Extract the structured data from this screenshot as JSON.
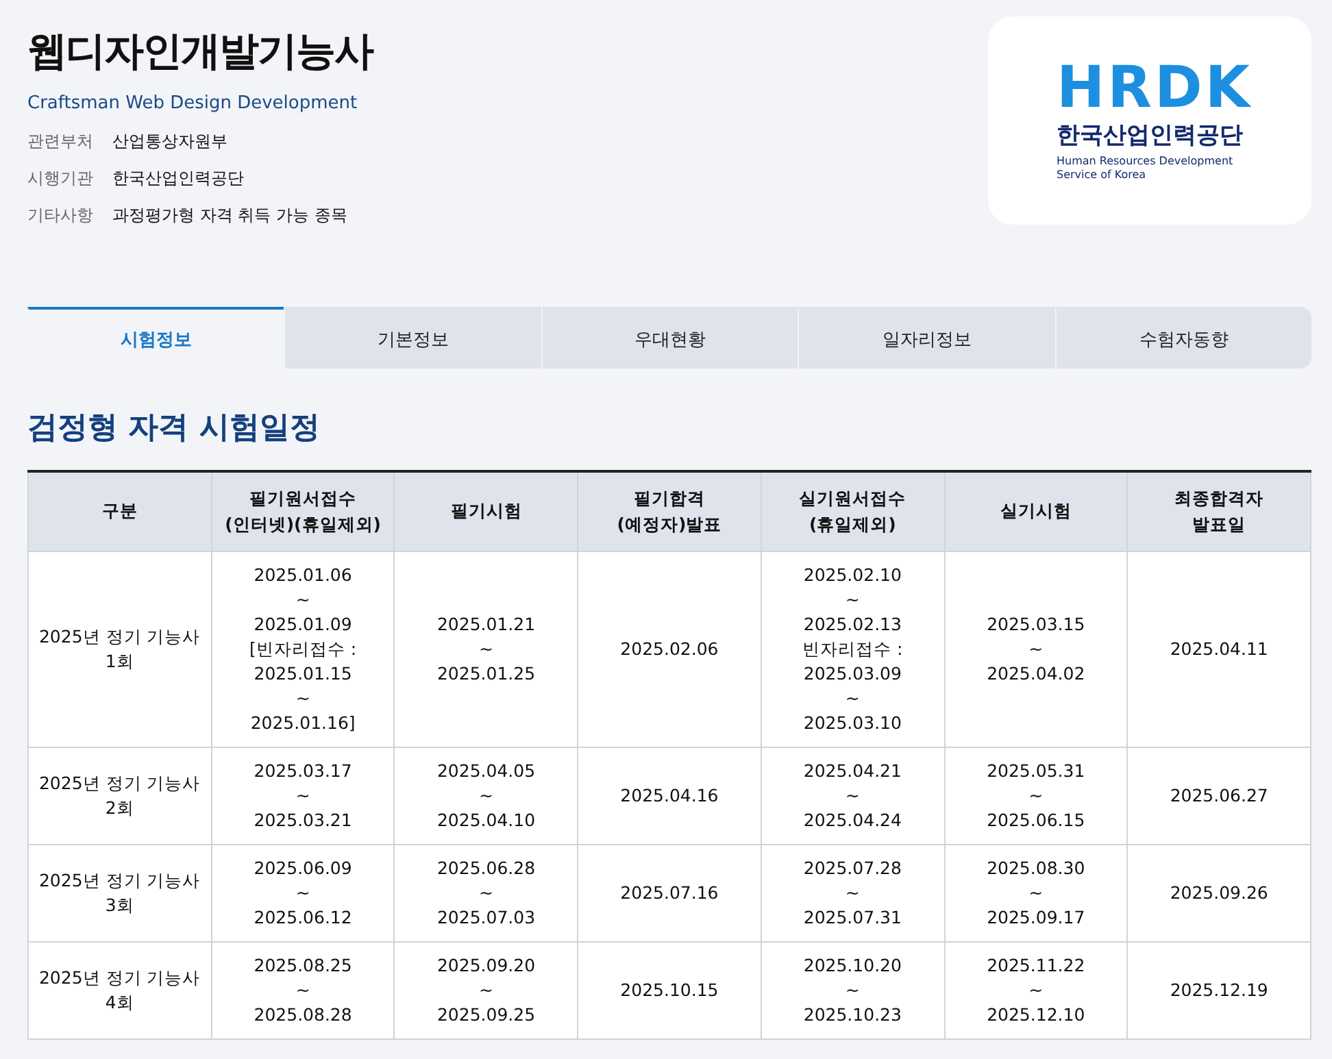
{
  "header": {
    "title": "웹디자인개발기능사",
    "subtitle": "Craftsman Web Design Development",
    "info": [
      {
        "label": "관련부처",
        "value": "산업통상자원부"
      },
      {
        "label": "시행기관",
        "value": "한국산업인력공단"
      },
      {
        "label": "기타사항",
        "value": "과정평가형 자격 취득 가능 종목"
      }
    ]
  },
  "logo": {
    "mark": "HRDK",
    "name": "한국산업인력공단",
    "english": "Human Resources Development\nService of Korea"
  },
  "tabs": [
    {
      "label": "시험정보",
      "selected": true
    },
    {
      "label": "기본정보",
      "selected": false
    },
    {
      "label": "우대현황",
      "selected": false
    },
    {
      "label": "일자리정보",
      "selected": false
    },
    {
      "label": "수험자동향",
      "selected": false
    }
  ],
  "section_title": "검정형 자격 시험일정",
  "table": {
    "columns": [
      "구분",
      "필기원서접수\n(인터넷)(휴일제외)",
      "필기시험",
      "필기합격\n(예정자)발표",
      "실기원서접수\n(휴일제외)",
      "실기시험",
      "최종합격자\n발표일"
    ],
    "rows": [
      [
        "2025년 정기 기능사\n1회",
        "2025.01.06\n~\n2025.01.09\n[빈자리접수 :\n2025.01.15\n~\n2025.01.16]",
        "2025.01.21\n~\n2025.01.25",
        "2025.02.06",
        "2025.02.10\n~\n2025.02.13\n빈자리접수 :\n2025.03.09\n~\n2025.03.10",
        "2025.03.15\n~\n2025.04.02",
        "2025.04.11"
      ],
      [
        "2025년 정기 기능사\n2회",
        "2025.03.17\n~\n2025.03.21",
        "2025.04.05\n~\n2025.04.10",
        "2025.04.16",
        "2025.04.21\n~\n2025.04.24",
        "2025.05.31\n~\n2025.06.15",
        "2025.06.27"
      ],
      [
        "2025년 정기 기능사\n3회",
        "2025.06.09\n~\n2025.06.12",
        "2025.06.28\n~\n2025.07.03",
        "2025.07.16",
        "2025.07.28\n~\n2025.07.31",
        "2025.08.30\n~\n2025.09.17",
        "2025.09.26"
      ],
      [
        "2025년 정기 기능사\n4회",
        "2025.08.25\n~\n2025.08.28",
        "2025.09.20\n~\n2025.09.25",
        "2025.10.15",
        "2025.10.20\n~\n2025.10.23",
        "2025.11.22\n~\n2025.12.10",
        "2025.12.19"
      ]
    ]
  }
}
